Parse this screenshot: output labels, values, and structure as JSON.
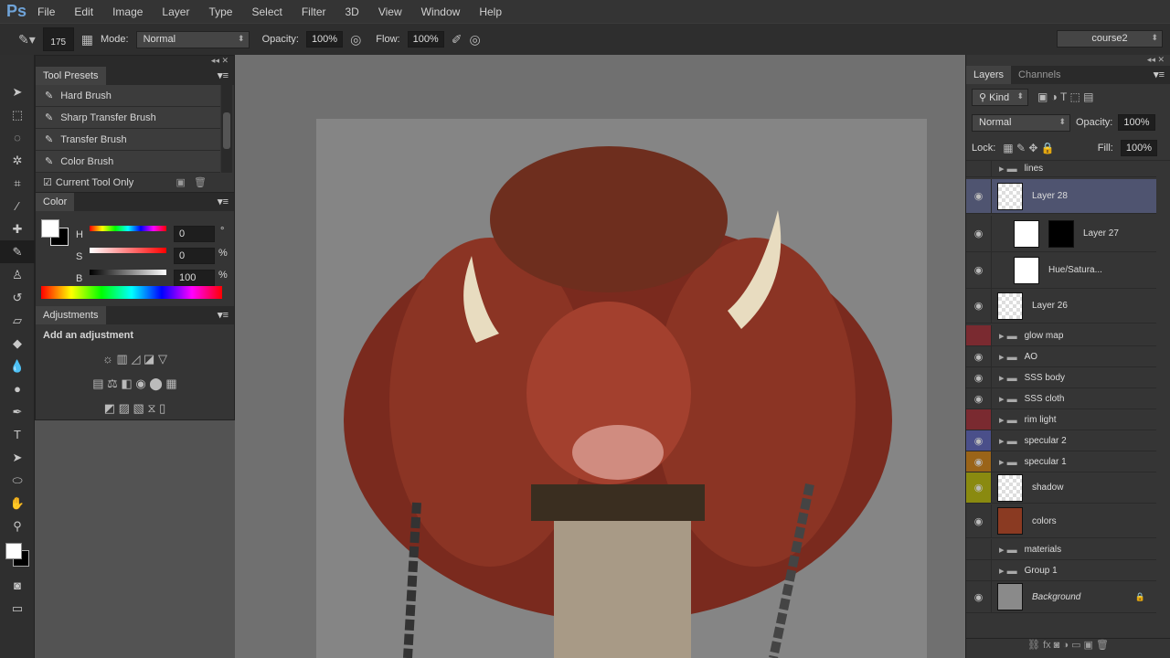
{
  "app": {
    "logo": "Ps",
    "menu": [
      "File",
      "Edit",
      "Image",
      "Layer",
      "Type",
      "Select",
      "Filter",
      "3D",
      "View",
      "Window",
      "Help"
    ]
  },
  "options": {
    "brush_size": "175",
    "mode_label": "Mode:",
    "mode": "Normal",
    "opacity_label": "Opacity:",
    "opacity": "100%",
    "flow_label": "Flow:",
    "flow": "100%",
    "workspace": "course2"
  },
  "tool_presets": {
    "title": "Tool Presets",
    "items": [
      "Hard Brush",
      "Sharp Transfer Brush",
      "Transfer Brush",
      "Color Brush"
    ],
    "current_tool_only": "Current Tool Only"
  },
  "color": {
    "title": "Color",
    "h_label": "H",
    "s_label": "S",
    "b_label": "B",
    "h": "0",
    "s": "0",
    "b": "100",
    "h_unit": "°",
    "s_unit": "%",
    "b_unit": "%"
  },
  "adjustments": {
    "title": "Adjustments",
    "subtitle": "Add an adjustment"
  },
  "layers_panel": {
    "tabs": [
      "Layers",
      "Channels"
    ],
    "kind": "Kind",
    "blend": "Normal",
    "opacity_label": "Opacity:",
    "opacity": "100%",
    "lock_label": "Lock:",
    "fill_label": "Fill:",
    "fill": "100%",
    "layers": [
      {
        "name": "lines",
        "type": "group",
        "visible": false,
        "color": ""
      },
      {
        "name": "Layer 28",
        "type": "pixel",
        "visible": true,
        "selected": true,
        "color": ""
      },
      {
        "name": "Layer 27",
        "type": "masked",
        "visible": true,
        "color": ""
      },
      {
        "name": "Hue/Satura...",
        "type": "adjustment",
        "visible": true,
        "color": ""
      },
      {
        "name": "Layer 26",
        "type": "pixel",
        "visible": true,
        "color": ""
      },
      {
        "name": "glow map",
        "type": "group",
        "visible": false,
        "color": "#7a2a30"
      },
      {
        "name": "AO",
        "type": "group",
        "visible": true,
        "color": ""
      },
      {
        "name": "SSS body",
        "type": "group",
        "visible": true,
        "color": ""
      },
      {
        "name": "SSS cloth",
        "type": "group",
        "visible": true,
        "color": ""
      },
      {
        "name": "rim light",
        "type": "group",
        "visible": false,
        "color": "#7a2a30"
      },
      {
        "name": "specular 2",
        "type": "group",
        "visible": true,
        "color": "#4a4f8a"
      },
      {
        "name": "specular 1",
        "type": "group",
        "visible": true,
        "color": "#9a6418"
      },
      {
        "name": "shadow",
        "type": "pixel",
        "visible": true,
        "color": "#8a8a10"
      },
      {
        "name": "colors",
        "type": "pixel",
        "visible": true,
        "color": ""
      },
      {
        "name": "materials",
        "type": "group",
        "visible": false,
        "color": ""
      },
      {
        "name": "Group 1",
        "type": "group",
        "visible": false,
        "color": ""
      },
      {
        "name": "Background",
        "type": "background",
        "visible": true,
        "color": ""
      }
    ]
  }
}
